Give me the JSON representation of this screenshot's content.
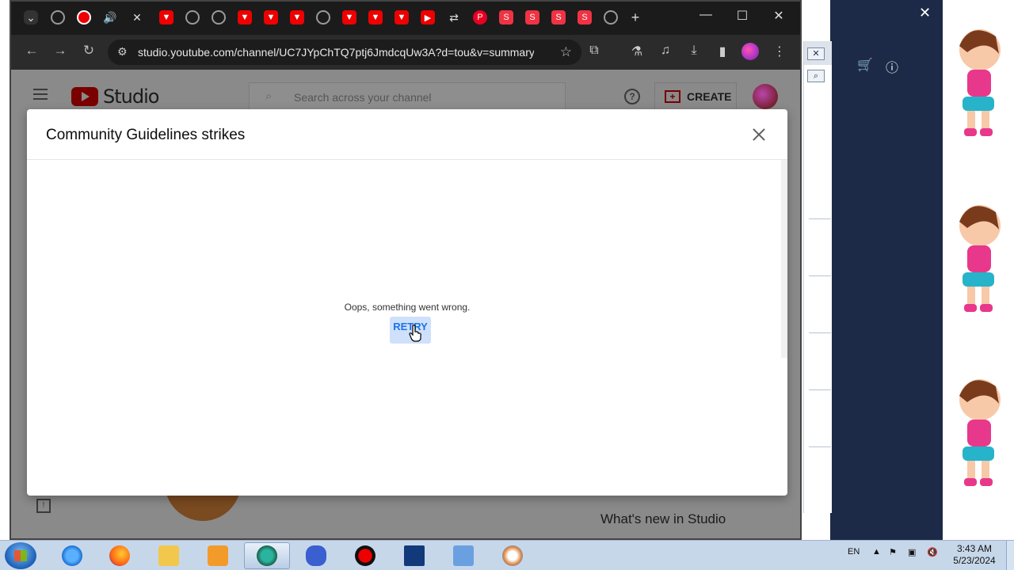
{
  "browser": {
    "url": "studio.youtube.com/channel/UC7JYpChTQ7ptj6JmdcqUw3A?d=tou&v=summary...",
    "new_tab_label": "+"
  },
  "studio": {
    "logo_text": "Studio",
    "search_placeholder": "Search across your channel",
    "create_label": "CREATE",
    "whats_new": "What's new in Studio"
  },
  "modal": {
    "title": "Community Guidelines strikes",
    "error_message": "Oops, something went wrong.",
    "retry_label": "RETRY"
  },
  "taskbar": {
    "language": "EN",
    "time": "3:43 AM",
    "date": "5/23/2024"
  },
  "icons": {
    "browser_back": "arrow-left-icon",
    "browser_forward": "arrow-right-icon",
    "reload": "reload-icon",
    "site_info": "tune-icon",
    "bookmark": "star-icon",
    "extensions": "puzzle-icon",
    "downloads": "download-icon"
  },
  "colors": {
    "retry_text": "#1a73e8",
    "retry_bg": "#cfe0fb",
    "youtube_red": "#ff0000",
    "dim_overlay": "#8a8a8a",
    "right_panel": "#1d2a47",
    "taskbar": "#c7d7ea"
  }
}
